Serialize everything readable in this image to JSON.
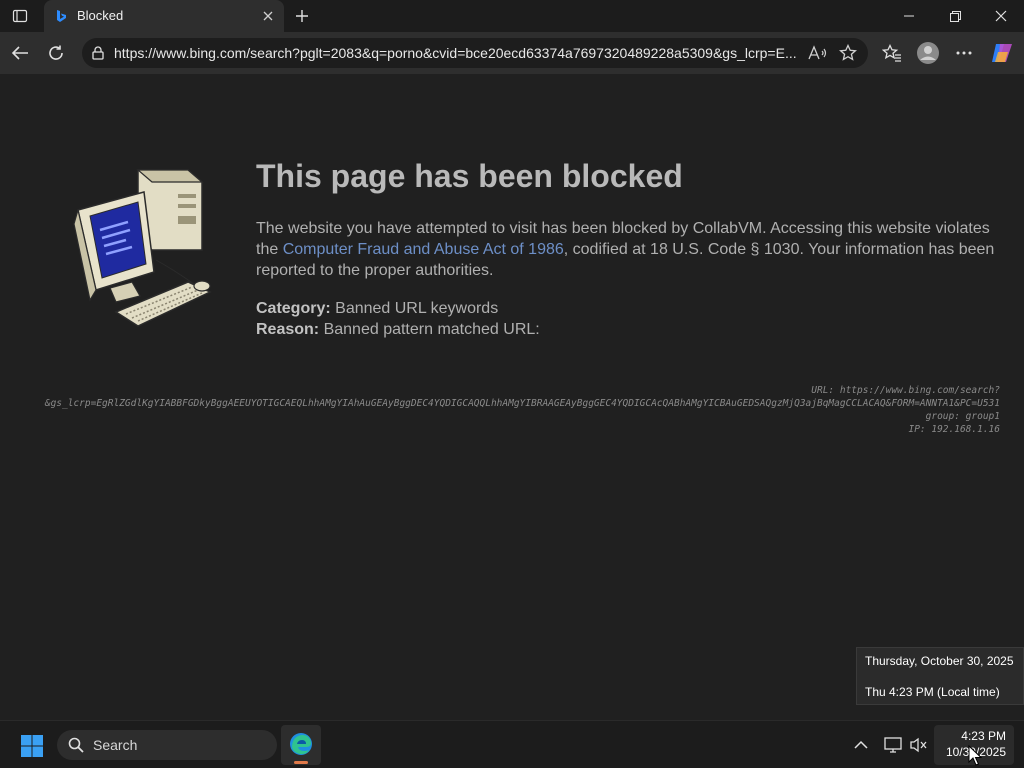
{
  "browser": {
    "tab": {
      "title": "Blocked"
    },
    "url": "https://www.bing.com/search?pglt=2083&q=porno&cvid=bce20ecd63374a7697320489228a5309&gs_lcrp=E..."
  },
  "page": {
    "heading": "This page has been blocked",
    "desc_before": "The website you have attempted to visit has been blocked by CollabVM. Accessing this website violates the ",
    "desc_link": "Computer Fraud and Abuse Act of 1986",
    "desc_after": ", codified at 18 U.S. Code § 1030. Your information has been reported to the proper authorities.",
    "category_label": "Category:",
    "category_value": "Banned URL keywords",
    "reason_label": "Reason:",
    "reason_value": "Banned pattern matched URL:",
    "debug": {
      "url_line": "URL: https://www.bing.com/search?",
      "query_line": "&gs_lcrp=EgRlZGdlKgYIABBFGDkyBggAEEUYOTIGCAEQLhhAMgYIAhAuGEAyBggDEC4YQDIGCAQQLhhAMgYIBRAAGEAyBggGEC4YQDIGCAcQABhAMgYICBAuGEDSAQgzMjQ3ajBqMagCCLACAQ&FORM=ANNTA1&PC=U531",
      "group_line": "group: group1",
      "ip_line": "IP: 192.168.1.16"
    }
  },
  "flyout": {
    "date": "Thursday, October 30, 2025",
    "time": "Thu 4:23 PM (Local time)"
  },
  "taskbar": {
    "search_label": "Search",
    "clock_time": "4:23 PM",
    "clock_date": "10/30/2025"
  },
  "colors": {
    "accent_link": "#6d8fc7",
    "page_bg": "#202020",
    "heading": "#b9b9b9"
  }
}
